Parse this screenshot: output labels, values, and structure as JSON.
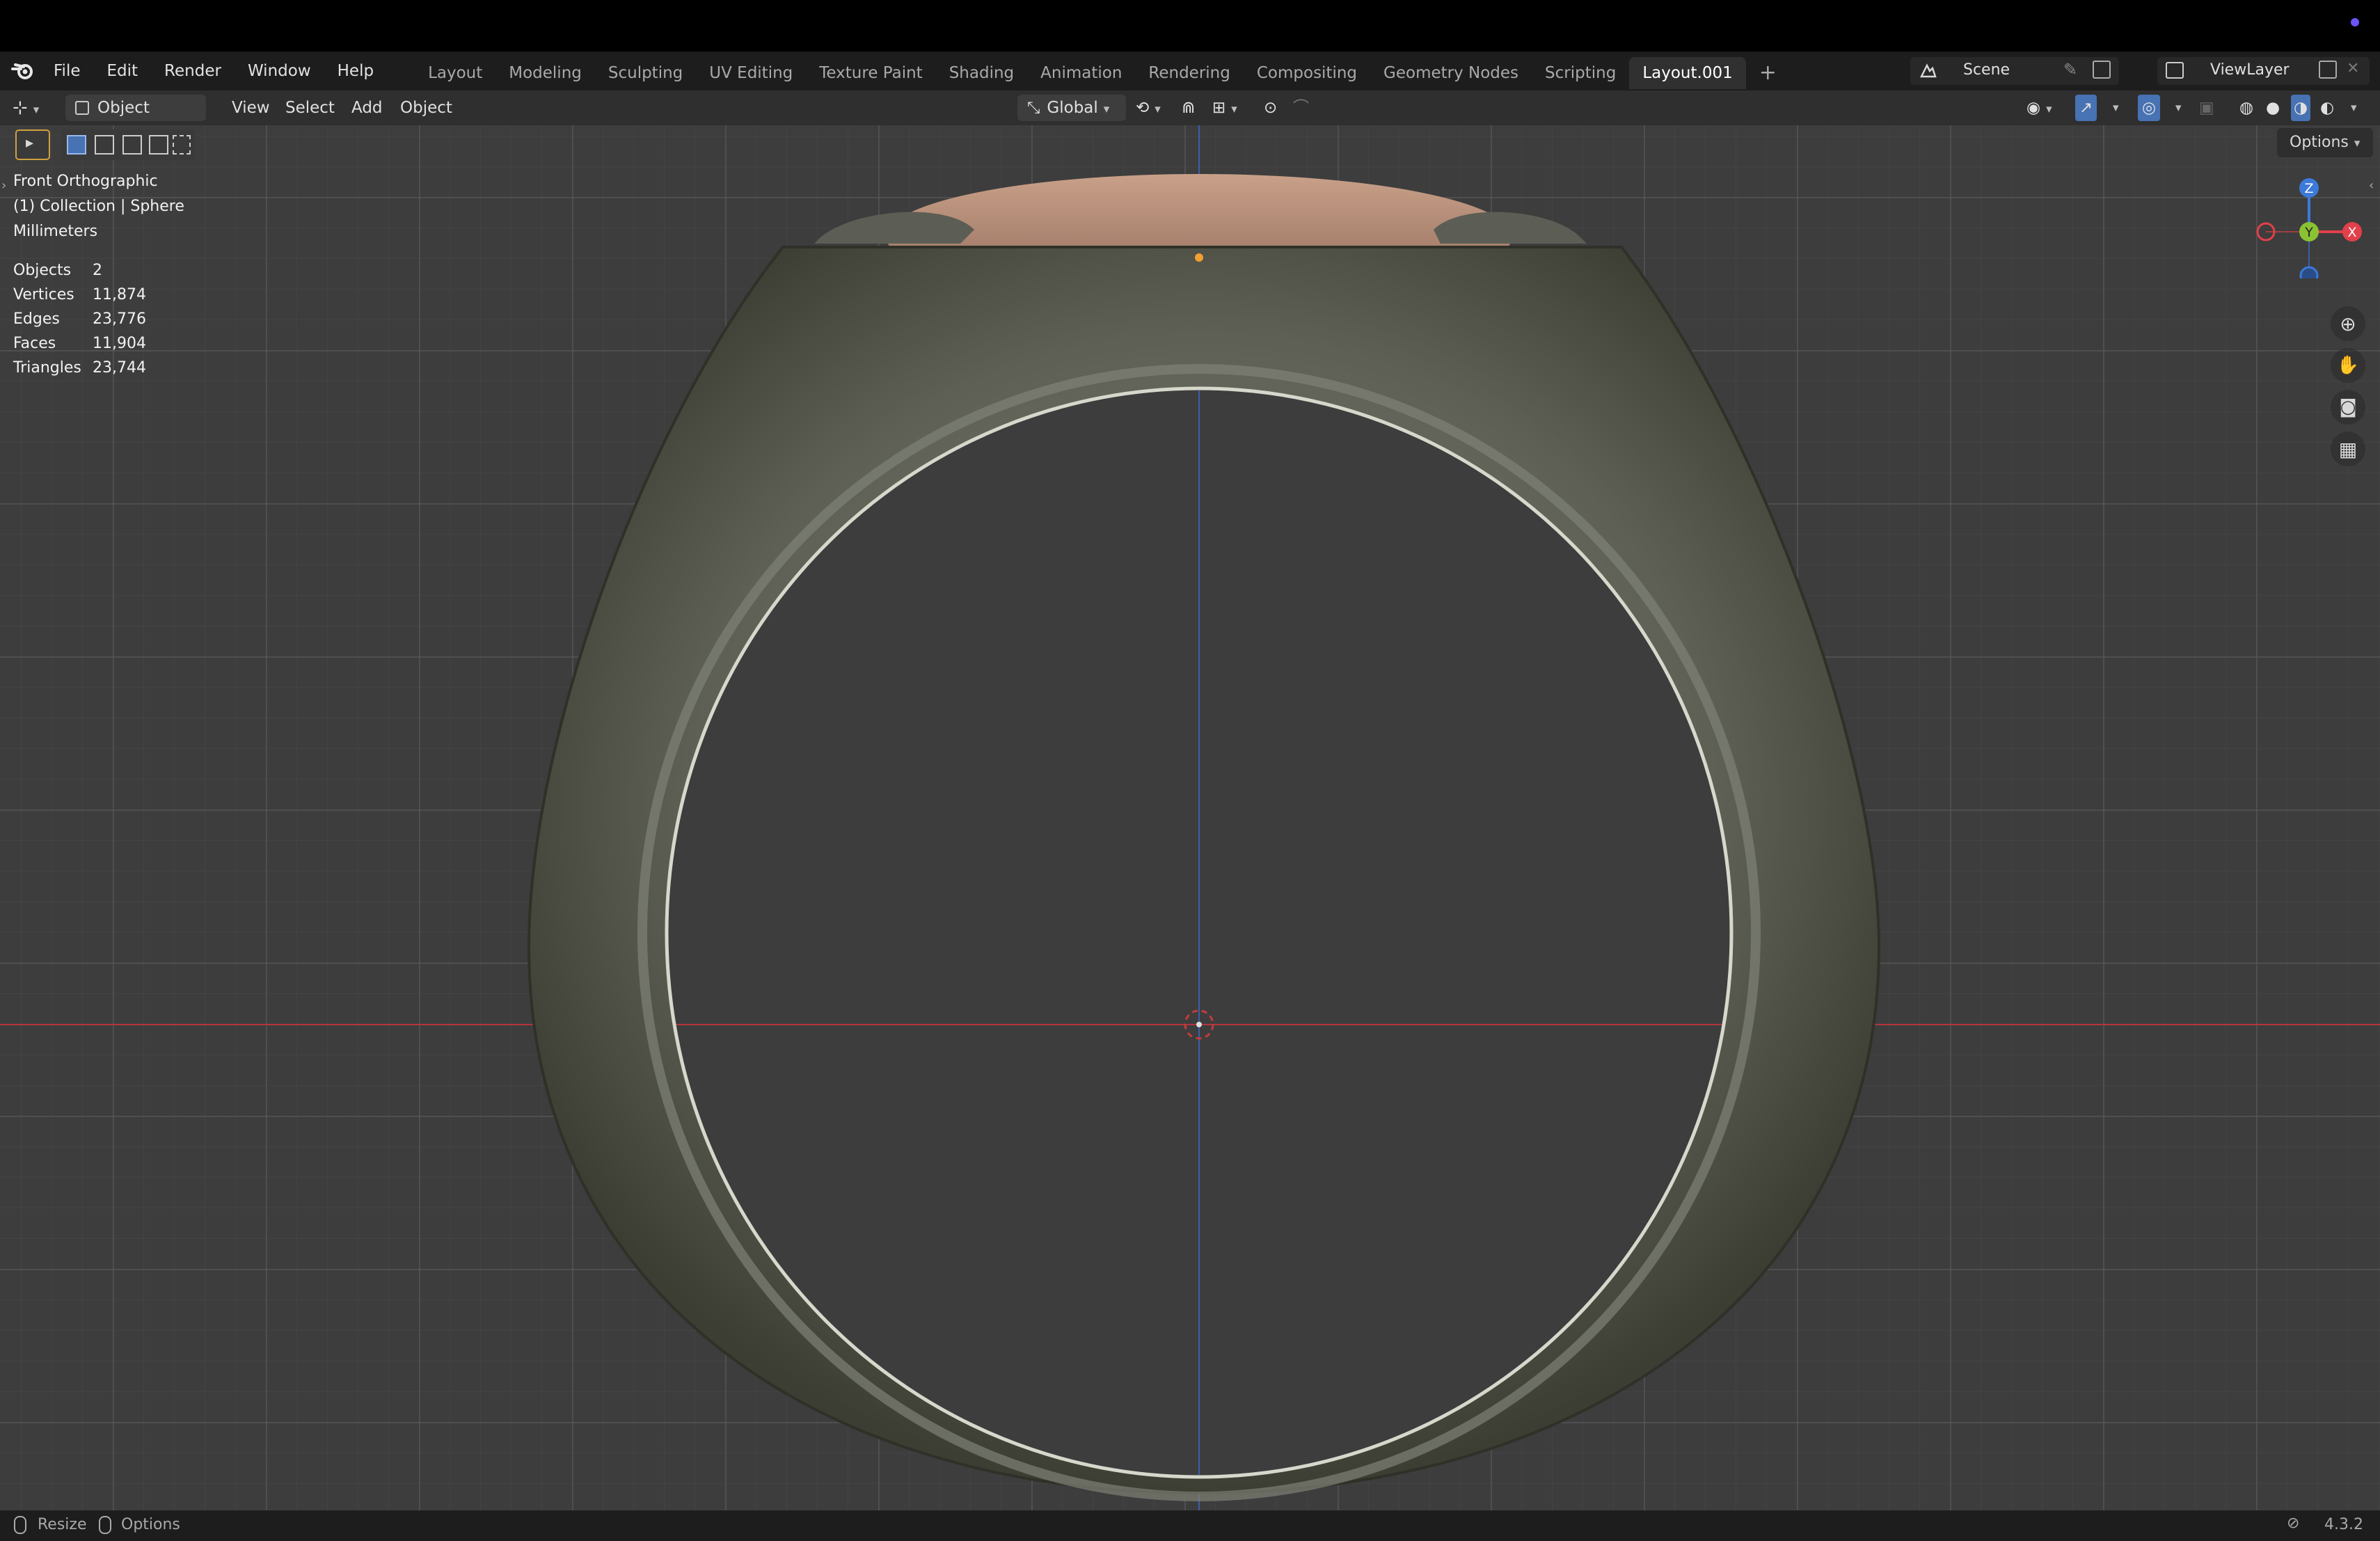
{
  "app": {
    "version": "4.3.2"
  },
  "menu": {
    "items": [
      "File",
      "Edit",
      "Render",
      "Window",
      "Help"
    ]
  },
  "workspaces": {
    "tabs": [
      "Layout",
      "Modeling",
      "Sculpting",
      "UV Editing",
      "Texture Paint",
      "Shading",
      "Animation",
      "Rendering",
      "Compositing",
      "Geometry Nodes",
      "Scripting",
      "Layout.001"
    ],
    "active": "Layout.001",
    "add_symbol": "+"
  },
  "scene": {
    "name": "Scene"
  },
  "view_layer": {
    "name": "ViewLayer"
  },
  "header": {
    "mode": "Object Mode",
    "menus": [
      "View",
      "Select",
      "Add",
      "Object"
    ],
    "orientation": "Global"
  },
  "viewport": {
    "view_name": "Front Orthographic",
    "collection_line": "(1) Collection | Sphere",
    "units": "Millimeters",
    "options_label": "Options",
    "stats": [
      {
        "label": "Objects",
        "value": "2"
      },
      {
        "label": "Vertices",
        "value": "11,874"
      },
      {
        "label": "Edges",
        "value": "23,776"
      },
      {
        "label": "Faces",
        "value": "11,904"
      },
      {
        "label": "Triangles",
        "value": "23,744"
      }
    ],
    "gizmo": {
      "z": "Z",
      "y": "Y",
      "x": "X"
    }
  },
  "statusbar": {
    "left": [
      "Resize",
      "Options"
    ],
    "version": "4.3.2"
  },
  "colors": {
    "x_axis": "#e2404a",
    "y_axis": "#8ac233",
    "z_axis": "#3b7ad9",
    "accent": "#4772b3"
  }
}
